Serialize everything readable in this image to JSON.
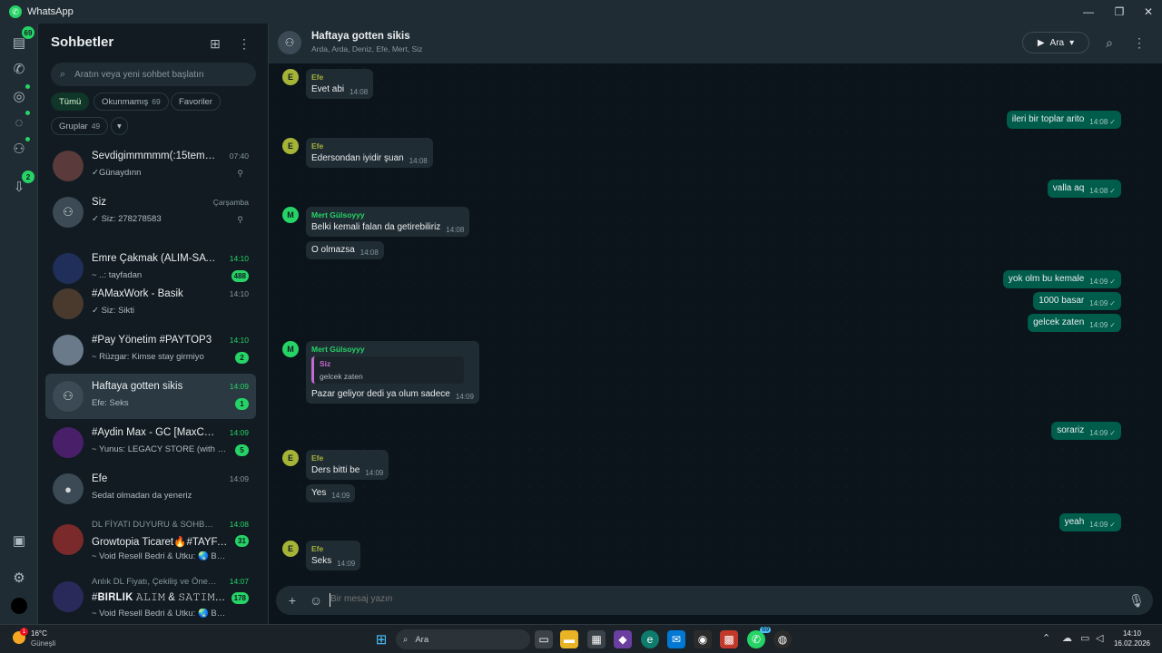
{
  "window": {
    "title": "WhatsApp"
  },
  "rail": {
    "chats_badge": "69",
    "updates_badge": "2"
  },
  "sidebar": {
    "title": "Sohbetler",
    "search_placeholder": "Aratın veya yeni sohbet başlatın",
    "filters": [
      {
        "label": "Tümü",
        "count": ""
      },
      {
        "label": "Okunmamış",
        "count": "69"
      },
      {
        "label": "Favoriler",
        "count": ""
      },
      {
        "label": "Gruplar",
        "count": "49"
      }
    ],
    "chats": [
      {
        "name": "Sevdigimmmmm(:15temmuz",
        "time": "07:40",
        "preview": "✓Günaydınn",
        "pinned": true
      },
      {
        "name": "Siz",
        "time": "Çarşamba",
        "preview": "✓ Siz: 278278583",
        "pinned": true
      },
      {
        "name": "Emre Çakmak (ALIM-SATIM) ...",
        "time": "14:10",
        "preview": "~ ..: tayfadan",
        "badge": "488"
      },
      {
        "name": "#AMaxWork - Basik",
        "time": "14:10",
        "preview": "✓ Siz: Sikti"
      },
      {
        "name": "#Pay Yönetim #PAYTOP3",
        "time": "14:10",
        "preview": "~ Rüzgar: Kimse stay girmiyo",
        "badge": "2"
      },
      {
        "name": "Haftaya gotten sikis",
        "time": "14:09",
        "preview": "Efe: Seks",
        "badge": "1"
      },
      {
        "name": "#Aydin Max - GC [MaxCoin81]",
        "time": "14:09",
        "preview": "~ Yunus: LEGACY STORE (with mail...",
        "badge": "5"
      },
      {
        "name": "Efe",
        "time": "14:09",
        "preview": "Sedat olmadan da yeneriz"
      },
      {
        "community": "DL FİYATI DUYURU & SOHBET & Ç...",
        "name": "Growtopia Ticaret🔥#TAYFA [...",
        "time": "14:08",
        "preview": "~ Void Resell Bedri & Utku: 🌏 BGL EN D...",
        "badge": "31"
      },
      {
        "community": "Anlık DL Fiyatı, Çekiliş ve Önemli ...",
        "name": "#𝐁𝐈𝐑𝐋𝐈𝐊 𝙰𝙻𝙸𝙼 & 𝚂𝙰𝚃𝙸𝙼 #3 ...",
        "time": "14:07",
        "preview": "~ Void Resell Bedri & Utku: 🌏 BGL EN D...",
        "badge": "178"
      }
    ]
  },
  "conversation": {
    "name": "Haftaya gotten sikis",
    "members": "Arda, Arda, Deniz, Efe, Mert, Siz",
    "call_label": "Ara",
    "composer_placeholder": "Bir mesaj yazın",
    "messages": [
      {
        "dir": "in",
        "sender": "Efe",
        "text": "Evet abi",
        "time": "14:08"
      },
      {
        "dir": "out",
        "text": "ileri bir toplar arito",
        "time": "14:08"
      },
      {
        "dir": "in",
        "sender": "Efe",
        "text": "Edersondan iyidir şuan",
        "time": "14:08"
      },
      {
        "dir": "out",
        "text": "valla aq",
        "time": "14:08"
      },
      {
        "dir": "in",
        "sender": "Mert Gülsoyyy",
        "text": "Belki kemali falan da getirebiliriz",
        "time": "14:08"
      },
      {
        "dir": "in",
        "text": "O olmazsa",
        "time": "14:08"
      },
      {
        "dir": "out",
        "text": "yok olm bu kemale",
        "time": "14:09"
      },
      {
        "dir": "out",
        "text": "1000 basar",
        "time": "14:09"
      },
      {
        "dir": "out",
        "text": "gelcek zaten",
        "time": "14:09"
      },
      {
        "dir": "in",
        "sender": "Mert Gülsoyyy",
        "quote_sender": "Siz",
        "quote_text": "gelcek zaten",
        "text": "Pazar geliyor dedi ya olum sadece",
        "time": "14:09"
      },
      {
        "dir": "out",
        "text": "sorariz",
        "time": "14:09"
      },
      {
        "dir": "in",
        "sender": "Efe",
        "text": "Ders bitti be",
        "time": "14:09"
      },
      {
        "dir": "in",
        "text": "Yes",
        "time": "14:09"
      },
      {
        "dir": "out",
        "text": "yeah",
        "time": "14:09"
      },
      {
        "dir": "in",
        "sender": "Efe",
        "text": "Seks",
        "time": "14:09"
      }
    ]
  },
  "taskbar": {
    "temperature": "16°C",
    "weather": "Güneşli",
    "weather_badge": "1",
    "search_label": "Ara",
    "whatsapp_badge": "69",
    "time": "14:10",
    "date": "16.02.2026"
  },
  "colors": {
    "accent": "#25d366",
    "outgoing": "#005c4b",
    "incoming": "#202c33",
    "efe": "#a5b337",
    "mert": "#25d366",
    "quote": "#c56acf"
  }
}
